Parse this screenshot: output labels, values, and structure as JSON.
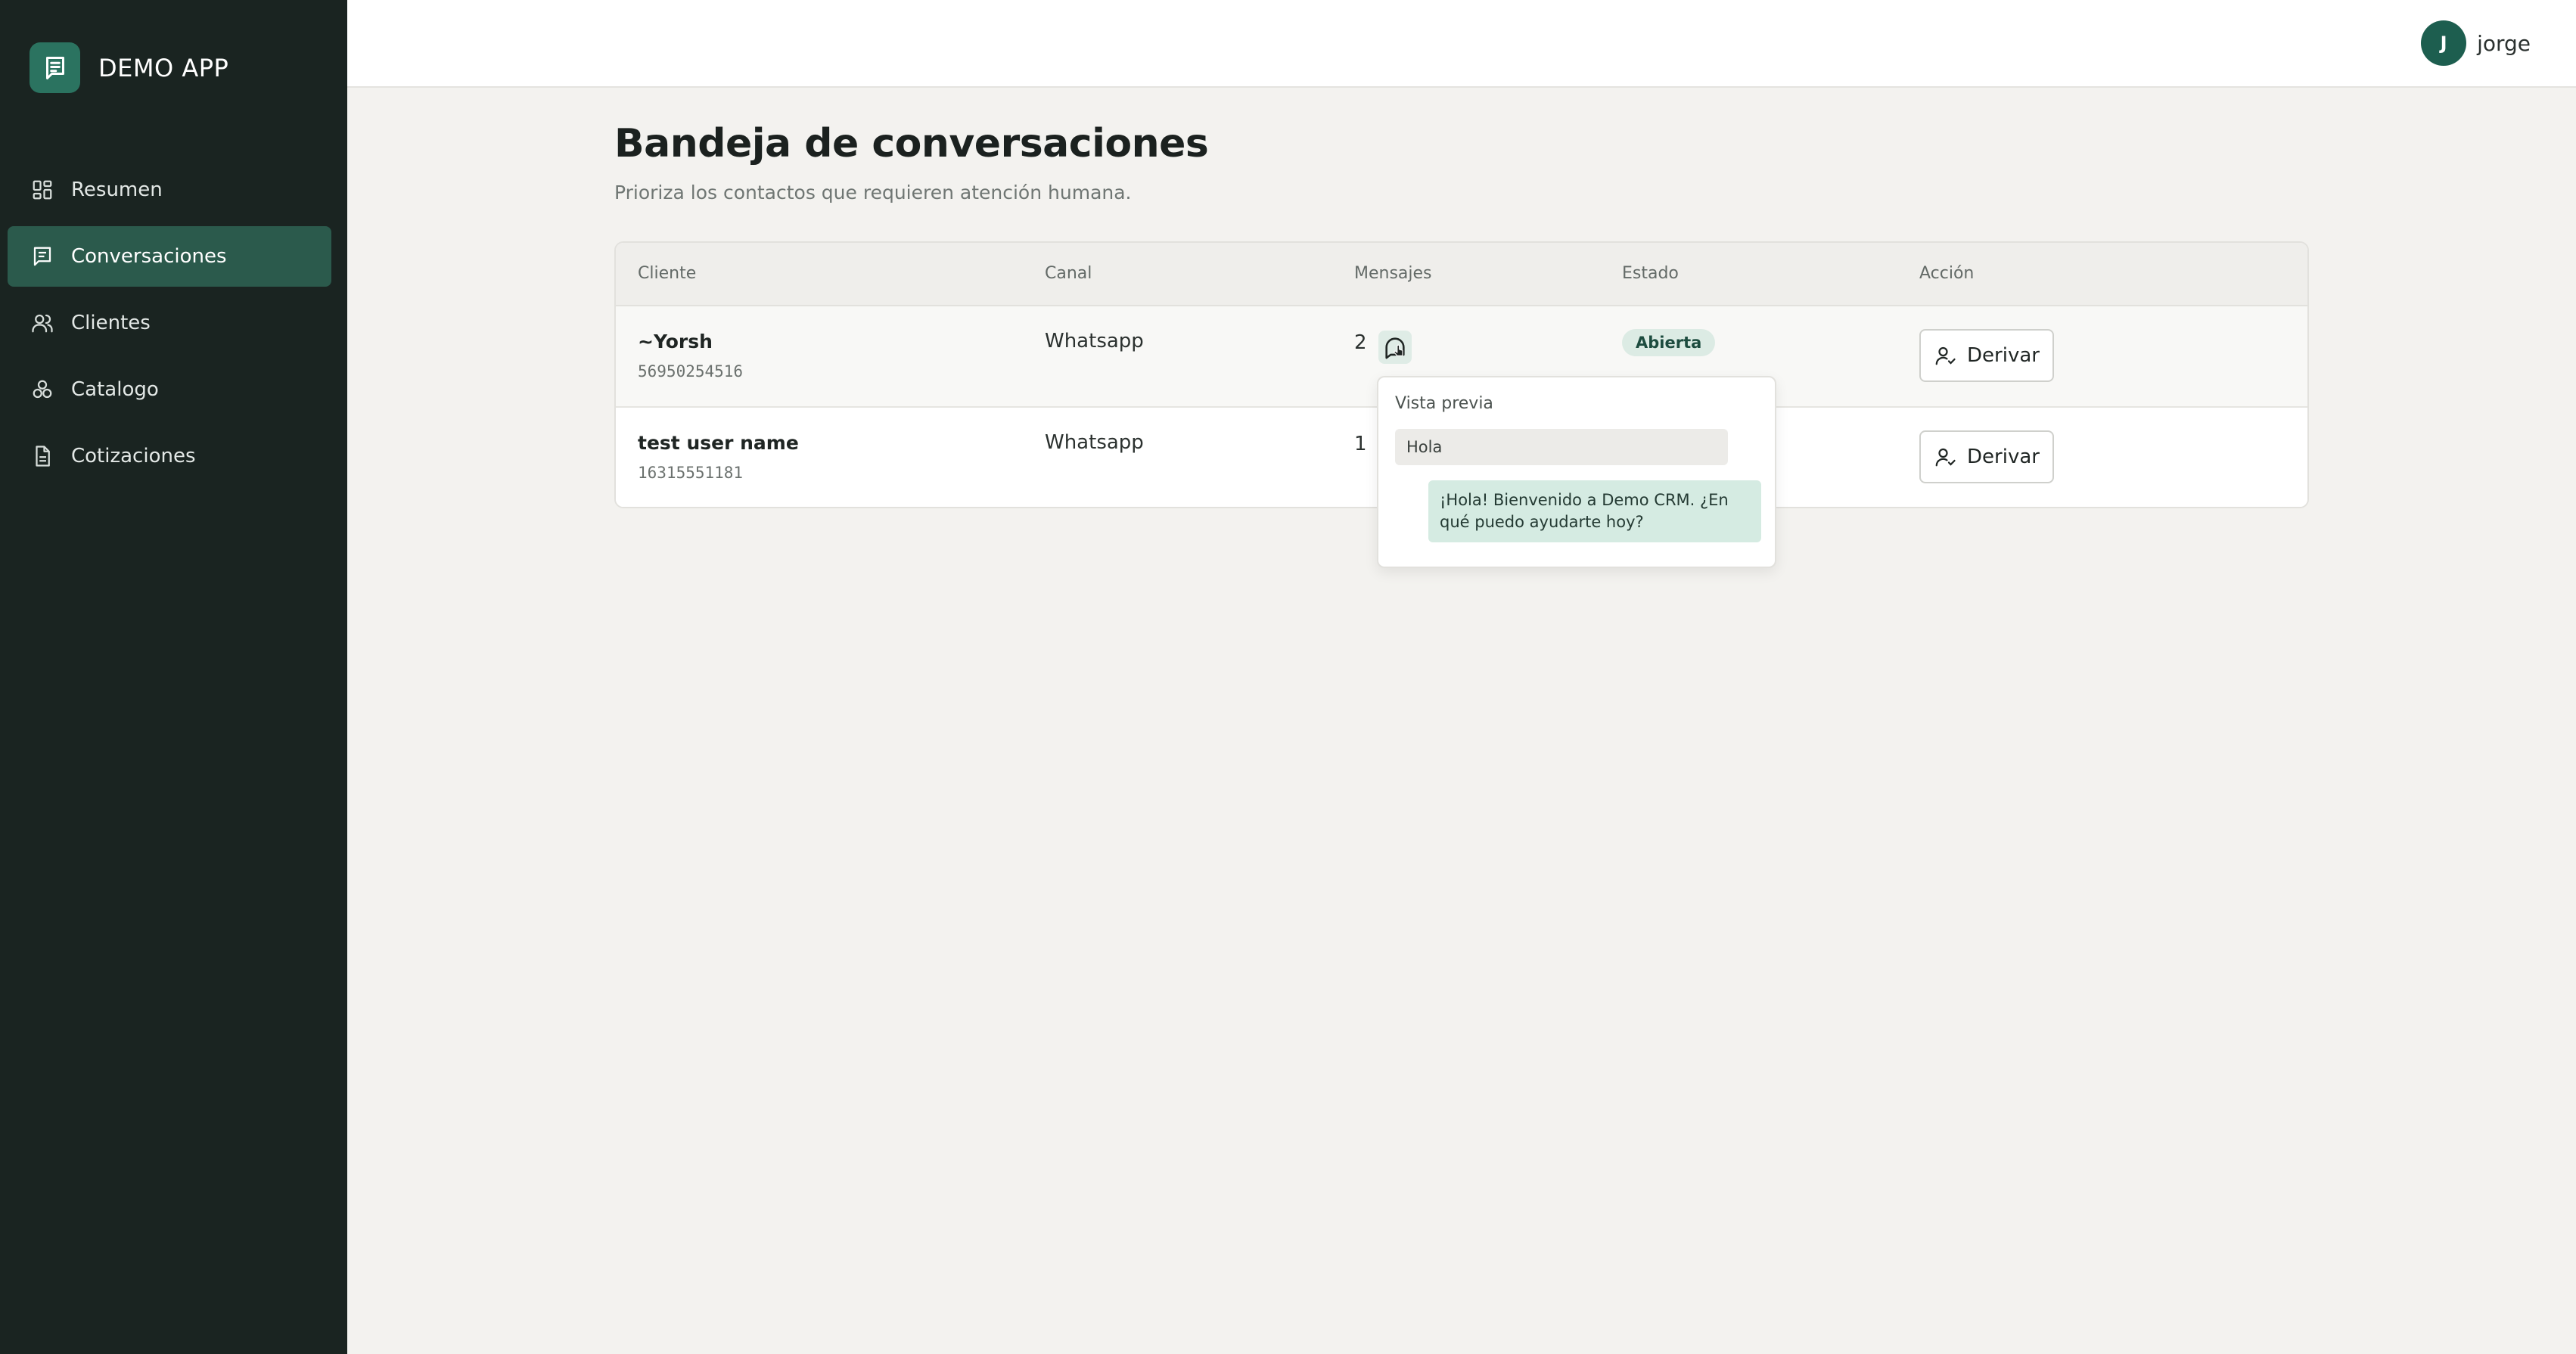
{
  "app": {
    "name": "DEMO APP"
  },
  "sidebar": {
    "items": [
      {
        "label": "Resumen",
        "icon": "grid-icon",
        "active": false
      },
      {
        "label": "Conversaciones",
        "icon": "chat-icon",
        "active": true
      },
      {
        "label": "Clientes",
        "icon": "users-icon",
        "active": false
      },
      {
        "label": "Catalogo",
        "icon": "shapes-icon",
        "active": false
      },
      {
        "label": "Cotizaciones",
        "icon": "document-icon",
        "active": false
      }
    ]
  },
  "user": {
    "initial": "J",
    "name": "jorge"
  },
  "page": {
    "title": "Bandeja de conversaciones",
    "subtitle": "Prioriza los contactos que requieren atención humana."
  },
  "table": {
    "headers": [
      "Cliente",
      "Canal",
      "Mensajes",
      "Estado",
      "Acción"
    ],
    "rows": [
      {
        "name": "~Yorsh",
        "phone": "56950254516",
        "channel": "Whatsapp",
        "messages": "2",
        "status": "Abierta",
        "action": "Derivar"
      },
      {
        "name": "test user name",
        "phone": "16315551181",
        "channel": "Whatsapp",
        "messages": "1",
        "status": "",
        "action": "Derivar"
      }
    ]
  },
  "preview": {
    "title": "Vista previa",
    "incoming": "Hola",
    "outgoing": "¡Hola! Bienvenido a Demo CRM. ¿En qué puedo ayudarte hoy?"
  },
  "colors": {
    "sidebar": "#1a2421",
    "accent": "#2b7360",
    "active_nav": "#2b5a4c",
    "background": "#f3f2ef"
  }
}
